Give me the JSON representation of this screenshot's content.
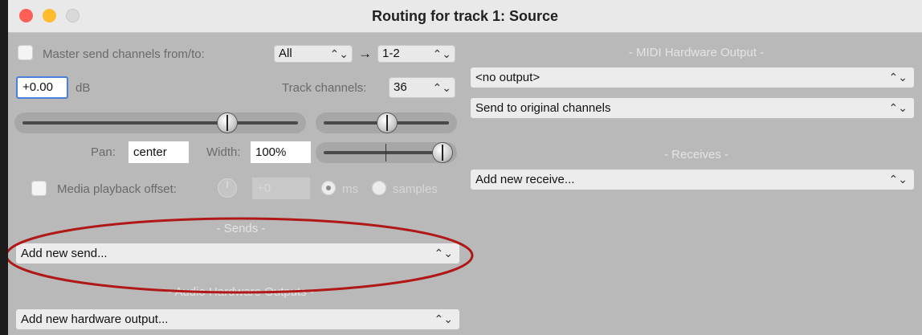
{
  "window": {
    "title": "Routing for track 1: Source"
  },
  "master_send": {
    "checkbox_label": "Master send channels from/to:",
    "from_value": "All",
    "to_value": "1-2"
  },
  "volume": {
    "value": "+0.00",
    "unit": "dB"
  },
  "track_channels": {
    "label": "Track channels:",
    "value": "36"
  },
  "pan": {
    "label": "Pan:",
    "value": "center"
  },
  "width": {
    "label": "Width:",
    "value": "100%"
  },
  "media_offset": {
    "label": "Media playback offset:",
    "value": "+0",
    "unit_ms": "ms",
    "unit_samples": "samples"
  },
  "sends": {
    "header": "- Sends -",
    "dropdown": "Add new send..."
  },
  "audio_hw": {
    "header": "- Audio Hardware Outputs -",
    "dropdown": "Add new hardware output..."
  },
  "midi_hw": {
    "header": "- MIDI Hardware Output -",
    "output": "<no output>",
    "channels": "Send to original channels"
  },
  "receives": {
    "header": "- Receives -",
    "dropdown": "Add new receive..."
  },
  "icons": {
    "arrow": "→",
    "chevron": "⌃⌄"
  },
  "colors": {
    "annotation_ellipse": "#b01818",
    "focus_ring": "#4a7fe0"
  }
}
